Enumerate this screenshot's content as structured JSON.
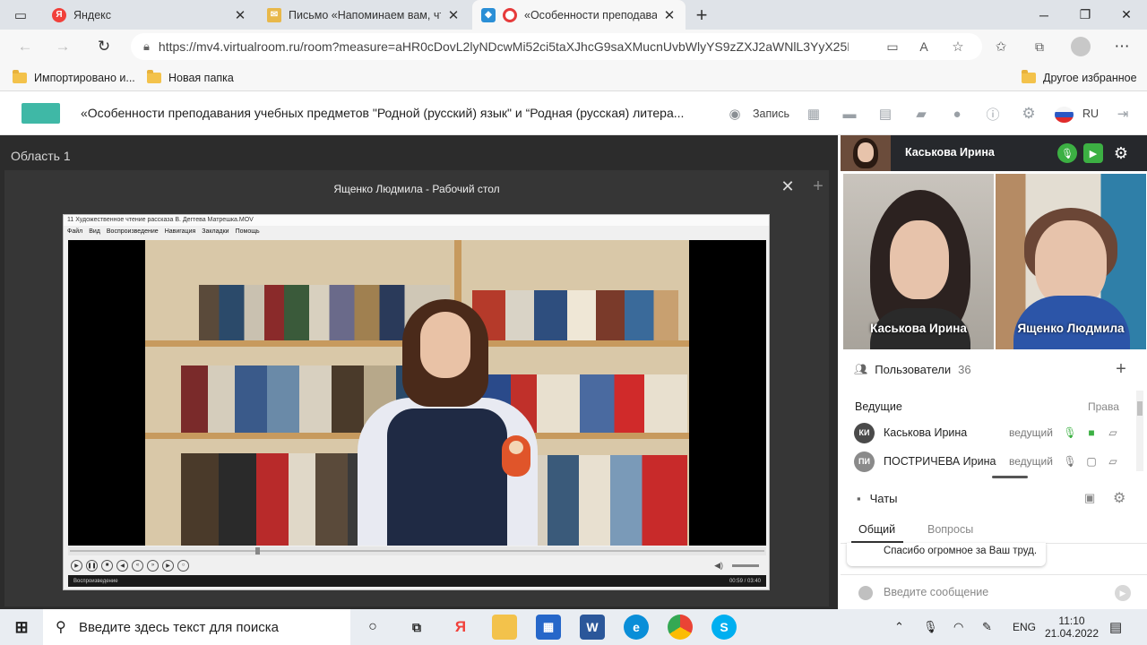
{
  "browser": {
    "tabs": [
      {
        "title": "Яндекс",
        "icon": "yandex-icon",
        "color": "#f1403a",
        "active": false
      },
      {
        "title": "Письмо «Напоминаем вам, что",
        "icon": "mail-icon",
        "color": "#e8b84a",
        "active": false
      },
      {
        "title": "«Особенности преподава",
        "icon": "record-icon",
        "color": "#e63b3b",
        "active": true
      }
    ],
    "url": "https://mv4.virtualroom.ru/room?measure=aHR0cDovL2lyNDcwMi52ci5taXJhcG9saXMucnUvbWlyYS9zZXJ2aWNlL3YyX25DZ...",
    "bookmarks": [
      "Импортировано и...",
      "Новая папка"
    ],
    "other_bookmarks": "Другое избранное"
  },
  "app": {
    "title": "«Особенности преподавания учебных предметов \"Родной (русский) язык\" и “Родная (русская) литера...",
    "record_label": "Запись",
    "lang": "RU",
    "accent": "#3fb8a6"
  },
  "stage": {
    "area_label": "Область 1",
    "share_title": "Ященко Людмила - Рабочий стол",
    "player": {
      "title": "11 Художественное чтение рассказа В. Дегтева Матрешка.MOV",
      "menu": [
        "Файл",
        "Вид",
        "Воспроизведение",
        "Навигация",
        "Закладки",
        "Помощь"
      ],
      "status": "Воспроизведение",
      "time": "00:59 / 03:40",
      "progress": 0.27
    }
  },
  "participants": {
    "me": "Каськова Ирина",
    "cams": [
      "Каськова Ирина",
      "Ященко Людмила"
    ],
    "users_label": "Пользователи",
    "users_count": "36",
    "leaders_label": "Ведущие",
    "rights_label": "Права",
    "list": [
      {
        "initials": "КИ",
        "name": "Каськова Ирина",
        "role": "ведущий"
      },
      {
        "initials": "ПИ",
        "name": "ПОСТРИЧЕВА Ирина",
        "role": "ведущий"
      }
    ]
  },
  "chat": {
    "title": "Чаты",
    "tabs": [
      "Общий",
      "Вопросы"
    ],
    "message": "Спасибо огромное за Ваш труд.",
    "input_placeholder": "Введите сообщение"
  },
  "taskbar": {
    "search_placeholder": "Введите здесь текст для поиска",
    "lang": "ENG",
    "time": "11:10",
    "date": "21.04.2022"
  }
}
